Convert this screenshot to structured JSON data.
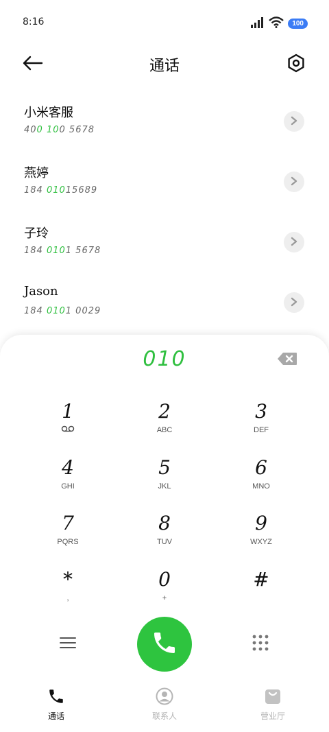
{
  "status_bar": {
    "time": "8:16",
    "battery": "100",
    "icons": [
      "signal-icon",
      "wifi-icon",
      "battery-icon"
    ]
  },
  "header": {
    "title": "通话",
    "back_icon": "arrow-left-icon",
    "settings_icon": "hexagon-settings-icon"
  },
  "contacts": [
    {
      "name": "小米客服",
      "number_parts": [
        "40",
        "0",
        " ",
        "10",
        "0  5678"
      ],
      "highlight": [
        false,
        true,
        false,
        true,
        false
      ]
    },
    {
      "name": "燕婷",
      "number_parts": [
        "184  ",
        "010",
        "15689"
      ],
      "highlight": [
        false,
        true,
        false
      ]
    },
    {
      "name": "子玲",
      "number_parts": [
        "184  ",
        "010",
        "1  5678"
      ],
      "highlight": [
        false,
        true,
        false
      ]
    },
    {
      "name": "Jason",
      "number_parts": [
        "184  ",
        "010",
        "1  0029"
      ],
      "highlight": [
        false,
        true,
        false
      ]
    }
  ],
  "dialer": {
    "input_value": "010",
    "keys": [
      {
        "digit": "1",
        "letters": "",
        "icon": "voicemail-icon"
      },
      {
        "digit": "2",
        "letters": "ABC"
      },
      {
        "digit": "3",
        "letters": "DEF"
      },
      {
        "digit": "4",
        "letters": "GHI"
      },
      {
        "digit": "5",
        "letters": "JKL"
      },
      {
        "digit": "6",
        "letters": "MNO"
      },
      {
        "digit": "7",
        "letters": "PQRS"
      },
      {
        "digit": "8",
        "letters": "TUV"
      },
      {
        "digit": "9",
        "letters": "WXYZ"
      },
      {
        "digit": "*",
        "letters": ","
      },
      {
        "digit": "0",
        "letters": "+"
      },
      {
        "digit": "#",
        "letters": ""
      }
    ]
  },
  "bottom_nav": {
    "items": [
      {
        "label": "通话",
        "icon": "phone-icon",
        "active": true
      },
      {
        "label": "联系人",
        "icon": "person-icon",
        "active": false
      },
      {
        "label": "营业厅",
        "icon": "shopping-bag-icon",
        "active": false
      }
    ]
  },
  "colors": {
    "accent_green": "#2ec43f",
    "battery_blue": "#3b7cf5",
    "active_nav": "#111111",
    "inactive_nav": "#b5b5b5"
  }
}
